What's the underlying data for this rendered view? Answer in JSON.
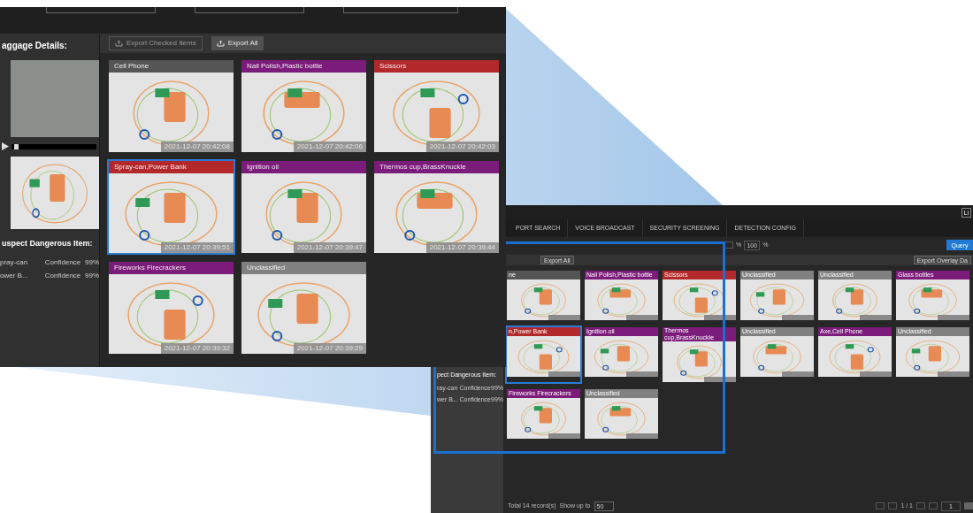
{
  "detail_view": {
    "sidebar": {
      "title": "aggage Details:",
      "suspect_title": "uspect Dangerous Item:",
      "suspects": [
        {
          "name": "pray-can",
          "label": "Confidence",
          "value": "99%"
        },
        {
          "name": "ower B...",
          "label": "Confidence",
          "value": "99%"
        }
      ]
    },
    "video": {
      "level": 0.03
    },
    "toolbar": [
      {
        "label": "Export Checked Items",
        "disabled": true
      },
      {
        "label": "Export All",
        "disabled": false
      }
    ],
    "cards": [
      {
        "title": "Cell Phone",
        "color": "#555555",
        "time": "2021-12-07 20:42:08",
        "selected": false
      },
      {
        "title": "Nail Polish,Plastic bottle",
        "color": "#7b1c7a",
        "time": "2021-12-07 20:42:06",
        "selected": false
      },
      {
        "title": "Scissors",
        "color": "#b3282a",
        "time": "2021-12-07 20:42:03",
        "selected": false
      },
      {
        "title": "Spray-can,Power Bank",
        "color": "#b3282a",
        "time": "2021-12-07 20:39:51",
        "selected": true
      },
      {
        "title": "Ignition oil",
        "color": "#7b1c7a",
        "time": "2021-12-07 20:39:47",
        "selected": false
      },
      {
        "title": "Thermos cup,BrassKnuckle",
        "color": "#7b1c7a",
        "time": "2021-12-07 20:39:44",
        "selected": false
      },
      {
        "title": "Fireworks Firecrackers",
        "color": "#7b1c7a",
        "time": "2021-12-07 20:39:32",
        "selected": false
      },
      {
        "title": "Unclassified",
        "color": "#808080",
        "time": "2021-12-07 20:39:29",
        "selected": false
      }
    ]
  },
  "background_view": {
    "tabs": [
      {
        "label": "PORT SEARCH",
        "selected": false
      },
      {
        "label": "VOICE BROADCAST",
        "selected": false
      },
      {
        "label": "SECURITY SCREENING",
        "selected": false
      },
      {
        "label": "DETECTION CONFIG",
        "selected": false
      }
    ],
    "top_button": "Li",
    "confidence_max": "100",
    "percent_sign": "%",
    "query_button": "Query",
    "export_all": "Export All",
    "export_overlay": "Export Overlay Da",
    "sidebar": {
      "suspect_title": "pect Dangerous Item:",
      "suspects": [
        {
          "name": "ray-can",
          "label": "Confidence",
          "value": "99%"
        },
        {
          "name": "wer B...",
          "label": "Confidence",
          "value": "99%"
        }
      ]
    },
    "cards": [
      {
        "title": "ne",
        "color": "#555555",
        "selected": false
      },
      {
        "title": "Nail Polish,Plastic bottle",
        "color": "#7b1c7a",
        "selected": false
      },
      {
        "title": "Scissors",
        "color": "#b3282a",
        "selected": false
      },
      {
        "title": "Unclassified",
        "color": "#808080",
        "selected": false
      },
      {
        "title": "Unclassified",
        "color": "#808080",
        "selected": false
      },
      {
        "title": "Glass bottles",
        "color": "#7b1c7a",
        "selected": false
      },
      {
        "title": "n,Power Bank",
        "color": "#b3282a",
        "selected": true
      },
      {
        "title": "Ignition oil",
        "color": "#7b1c7a",
        "selected": false
      },
      {
        "title": "Thermos cup,BrassKnuckle",
        "color": "#7b1c7a",
        "selected": false
      },
      {
        "title": "Unclassified",
        "color": "#808080",
        "selected": false
      },
      {
        "title": "Axe,Cell Phone",
        "color": "#7b1c7a",
        "selected": false
      },
      {
        "title": "Unclassified",
        "color": "#808080",
        "selected": false
      },
      {
        "title": "Fireworks Firecrackers",
        "color": "#7b1c7a",
        "selected": false
      },
      {
        "title": "Unclassified",
        "color": "#808080",
        "selected": false
      }
    ],
    "pagination": {
      "total": "Total 14 record(s)",
      "show_label": "Show up to",
      "page_size": "50",
      "page_info": "1 / 1",
      "page_input": "1"
    }
  }
}
